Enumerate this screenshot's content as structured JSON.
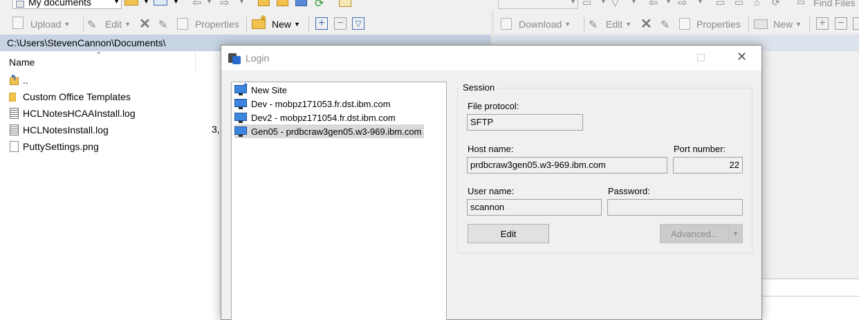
{
  "left_toolbar": {
    "location": "My documents",
    "upload": "Upload",
    "edit": "Edit",
    "properties": "Properties",
    "new": "New"
  },
  "right_toolbar": {
    "download": "Download",
    "edit": "Edit",
    "properties": "Properties",
    "new": "New",
    "find_files": "Find Files"
  },
  "left_panel": {
    "path": "C:\\Users\\StevenCannon\\Documents\\",
    "column_name": "Name",
    "size_fragment": "3,",
    "files": [
      {
        "name": "..",
        "icon": "parent-folder-icon"
      },
      {
        "name": "Custom Office Templates",
        "icon": "folder-icon"
      },
      {
        "name": "HCLNotesHCAAInstall.log",
        "icon": "text-file-icon"
      },
      {
        "name": "HCLNotesInstall.log",
        "icon": "text-file-icon"
      },
      {
        "name": "PuttySettings.png",
        "icon": "file-icon"
      }
    ]
  },
  "dialog": {
    "title": "Login",
    "sites": [
      {
        "label": "New Site",
        "selected": false
      },
      {
        "label": "Dev - mobpz171053.fr.dst.ibm.com",
        "selected": false
      },
      {
        "label": "Dev2 - mobpz171054.fr.dst.ibm.com",
        "selected": false
      },
      {
        "label": "Gen05 - prdbcraw3gen05.w3-969.ibm.com",
        "selected": true
      }
    ],
    "session_label": "Session",
    "file_protocol_label": "File protocol:",
    "file_protocol_value": "SFTP",
    "host_name_label": "Host name:",
    "host_name_value": "prdbcraw3gen05.w3-969.ibm.com",
    "port_label": "Port number:",
    "port_value": "22",
    "user_label": "User name:",
    "user_value": "scannon",
    "password_label": "Password:",
    "password_value": "",
    "edit_button": "Edit",
    "advanced_button": "Advanced..."
  }
}
